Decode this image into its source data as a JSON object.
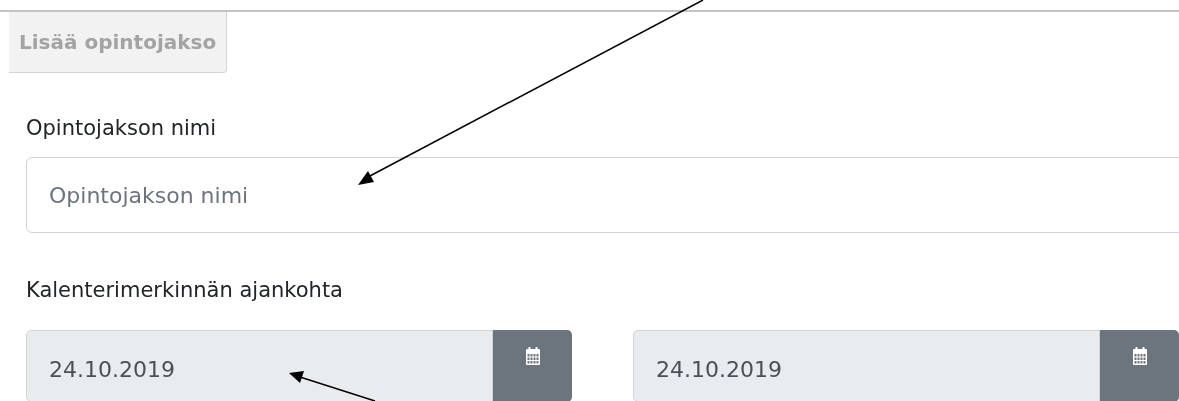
{
  "tab_button": {
    "label": "Lisää opintojakso"
  },
  "name_field": {
    "label": "Opintojakson nimi",
    "placeholder": "Opintojakson nimi"
  },
  "date_section": {
    "label": "Kalenterimerkinnän ajankohta",
    "dates": [
      {
        "value": "24.10.2019"
      },
      {
        "value": "24.10.2019"
      }
    ]
  }
}
